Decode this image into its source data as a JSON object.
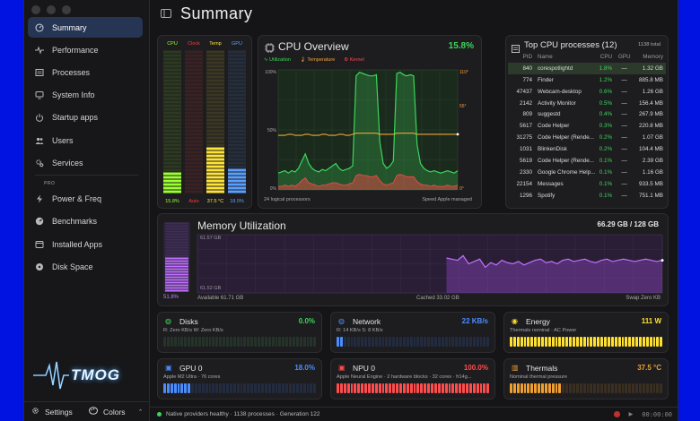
{
  "sidebar": {
    "items": [
      {
        "label": "Summary",
        "icon": "gauge-icon",
        "active": true
      },
      {
        "label": "Performance",
        "icon": "pulse-icon"
      },
      {
        "label": "Processes",
        "icon": "list-icon"
      },
      {
        "label": "System Info",
        "icon": "monitor-icon"
      },
      {
        "label": "Startup apps",
        "icon": "power-icon"
      },
      {
        "label": "Users",
        "icon": "users-icon"
      },
      {
        "label": "Services",
        "icon": "gears-icon"
      }
    ],
    "pro_label": "PRO",
    "pro_items": [
      {
        "label": "Power & Freq",
        "icon": "bolt-icon"
      },
      {
        "label": "Benchmarks",
        "icon": "speedometer-icon"
      },
      {
        "label": "Installed Apps",
        "icon": "apps-icon"
      },
      {
        "label": "Disk Space",
        "icon": "disk-icon"
      }
    ],
    "logo": "TMOG",
    "settings_label": "Settings",
    "colors_label": "Colors"
  },
  "header": {
    "title": "Summary"
  },
  "meters": {
    "labels": [
      "CPU",
      "Clock",
      "Temp",
      "GPU"
    ],
    "values": [
      "15.8%",
      "Auto",
      "37.5 °C",
      "18.0%"
    ],
    "levels": [
      0.16,
      0.0,
      0.33,
      0.18
    ],
    "colors": [
      "#9cff2e",
      "#ff3b3b",
      "#ffe438",
      "#5aa0ff"
    ]
  },
  "cpu_overview": {
    "title": "CPU Overview",
    "value": "15.8%",
    "legend": [
      {
        "label": "Utilization",
        "color": "#3ed55a"
      },
      {
        "label": "Temperature",
        "color": "#f3a43b"
      },
      {
        "label": "Kernel",
        "color": "#ff4a4a"
      }
    ],
    "y_left_top": "100%",
    "y_left_mid": "50%",
    "y_left_bot": "0%",
    "y_right_top": "110°",
    "y_right_mid": "55°",
    "y_right_bot": "0°",
    "footer_left": "24 logical processors",
    "footer_right": "Speed Apple managed"
  },
  "top_processes": {
    "title": "Top CPU processes (12)",
    "total": "1138 total",
    "columns": [
      "PID",
      "Name",
      "CPU",
      "GPU",
      "Memory"
    ],
    "rows": [
      [
        "840",
        "corespotlightd",
        "1.8%",
        "—",
        "1.32 GB"
      ],
      [
        "774",
        "Finder",
        "1.2%",
        "—",
        "885.8 MB"
      ],
      [
        "47437",
        "Webcam-desktop",
        "0.6%",
        "—",
        "1.26 GB"
      ],
      [
        "2142",
        "Activity Monitor",
        "0.5%",
        "—",
        "156.4 MB"
      ],
      [
        "809",
        "suggestd",
        "0.4%",
        "—",
        "267.9 MB"
      ],
      [
        "5617",
        "Code Helper",
        "0.3%",
        "—",
        "220.8 MB"
      ],
      [
        "31275",
        "Code Helper (Rende...",
        "0.2%",
        "—",
        "1.07 GB"
      ],
      [
        "1031",
        "BlinkenDisk",
        "0.2%",
        "—",
        "104.4 MB"
      ],
      [
        "5619",
        "Code Helper (Rende...",
        "0.1%",
        "—",
        "2.39 GB"
      ],
      [
        "2330",
        "Google Chrome Help...",
        "0.1%",
        "—",
        "1.16 GB"
      ],
      [
        "22154",
        "Messages",
        "0.1%",
        "—",
        "933.5 MB"
      ],
      [
        "1296",
        "Spotify",
        "0.1%",
        "—",
        "751.1 MB"
      ]
    ]
  },
  "memory": {
    "title": "Memory Utilization",
    "value": "66.29 GB / 128 GB",
    "percent": "51.8%",
    "level": 0.518,
    "y_top": "61.57 GB",
    "y_bot": "61.52 GB",
    "available": "Available 61.71 GB",
    "cached": "Cached 33.02 GB",
    "swap": "Swap Zero KB"
  },
  "cards": [
    {
      "key": "disks",
      "title": "Disks",
      "icon": "disk-icon",
      "value": "0.0%",
      "sub": "R: Zero KB/s   W: Zero KB/s",
      "color": "#3ed55a",
      "level": 0.0,
      "bg": "#25332a"
    },
    {
      "key": "network",
      "title": "Network",
      "icon": "globe-icon",
      "value": "22 KB/s",
      "sub": "R: 14 KB/s   S: 8 KB/s",
      "color": "#4a8dff",
      "level": 0.04,
      "bg": "#222b40"
    },
    {
      "key": "energy",
      "title": "Energy",
      "icon": "energy-icon",
      "value": "111 W",
      "sub": "Thermals nominal · AC Power",
      "color": "#ffe02e",
      "level": 1.0,
      "bg": "#3a3520"
    },
    {
      "key": "gpu",
      "title": "GPU 0",
      "icon": "gpu-icon",
      "value": "18.0%",
      "sub": "Apple M2 Ultra · 76 cores",
      "color": "#4a8dff",
      "level": 0.18,
      "bg": "#222b40"
    },
    {
      "key": "npu",
      "title": "NPU 0",
      "icon": "chip-icon",
      "value": "100.0%",
      "sub": "Apple Neural Engine · 2 hardware blocks · 32 cores · fr14g...",
      "color": "#ff4d4d",
      "level": 1.0,
      "bg": "#3a2224"
    },
    {
      "key": "thermals",
      "title": "Thermals",
      "icon": "thermometer-icon",
      "value": "37.5 °C",
      "sub": "Nominal thermal pressure",
      "color": "#f0a030",
      "level": 0.33,
      "bg": "#3a2f20"
    }
  ],
  "status": {
    "text": "Native providers healthy · 1138 processes · Generation 122",
    "time": "00:00:00"
  },
  "chart_data": [
    {
      "type": "line",
      "title": "CPU Overview",
      "ylim": [
        0,
        100
      ],
      "y2lim": [
        0,
        110
      ],
      "series": [
        {
          "name": "Utilization",
          "values": [
            14,
            15,
            16,
            14,
            16,
            15,
            18,
            24,
            30,
            22,
            18,
            16,
            15,
            17,
            16,
            18,
            20,
            22,
            18,
            16,
            17,
            18,
            20,
            95,
            98,
            97,
            96,
            95,
            95,
            96,
            40,
            22,
            18,
            20,
            24,
            97,
            98,
            96,
            95,
            96,
            95,
            38,
            22,
            18,
            16,
            15,
            16,
            15,
            14,
            15,
            16,
            15,
            14,
            16
          ]
        },
        {
          "name": "Temperature",
          "values": [
            50,
            50,
            50,
            51,
            51,
            50,
            50,
            50,
            51,
            51,
            50,
            50,
            50,
            51,
            51,
            50,
            50,
            50,
            51,
            51,
            50,
            50,
            51,
            52,
            52,
            52,
            52,
            52,
            52,
            52,
            51,
            51,
            51,
            51,
            51,
            52,
            52,
            52,
            52,
            52,
            52,
            51,
            51,
            51,
            51,
            51,
            51,
            51,
            51,
            51,
            51,
            51,
            51,
            51
          ]
        },
        {
          "name": "Kernel",
          "values": [
            3,
            3,
            4,
            3,
            4,
            3,
            5,
            8,
            10,
            6,
            5,
            4,
            3,
            4,
            4,
            5,
            6,
            6,
            5,
            4,
            4,
            5,
            6,
            12,
            13,
            12,
            12,
            11,
            11,
            12,
            8,
            5,
            4,
            5,
            6,
            12,
            13,
            12,
            11,
            11,
            11,
            7,
            5,
            4,
            4,
            3,
            4,
            3,
            3,
            3,
            4,
            3,
            3,
            4
          ]
        }
      ]
    },
    {
      "type": "line",
      "title": "Memory Utilization",
      "series": [
        {
          "name": "Memory",
          "values": [
            null,
            null,
            null,
            null,
            null,
            null,
            null,
            null,
            null,
            null,
            null,
            null,
            null,
            null,
            null,
            null,
            null,
            null,
            null,
            null,
            null,
            null,
            null,
            null,
            null,
            null,
            null,
            null,
            null,
            null,
            null,
            null,
            null,
            null,
            null,
            null,
            null,
            null,
            null,
            null,
            null,
            null,
            null,
            null,
            null,
            61.55,
            61.549,
            61.548,
            61.552,
            61.545,
            61.547,
            61.549,
            61.542,
            61.546,
            61.544,
            61.548,
            61.546,
            61.545,
            61.547,
            61.544,
            61.546,
            61.548,
            61.549,
            61.546,
            61.547,
            61.545,
            61.548,
            61.549,
            61.547,
            61.548,
            61.549,
            61.547,
            61.546,
            61.548,
            61.549,
            61.547,
            61.548,
            61.549,
            61.548,
            61.547,
            61.548,
            61.549,
            61.548,
            61.547,
            61.548
          ]
        }
      ],
      "ylim": [
        61.52,
        61.57
      ]
    }
  ]
}
